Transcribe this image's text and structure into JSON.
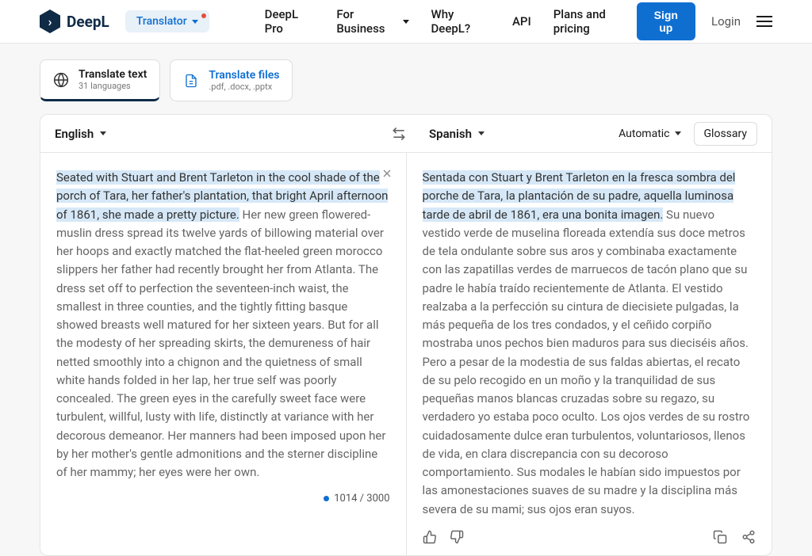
{
  "header": {
    "brand": "DeepL",
    "translator_label": "Translator",
    "nav": {
      "pro": "DeepL Pro",
      "business": "For Business",
      "why": "Why DeepL?",
      "api": "API",
      "plans": "Plans and pricing"
    },
    "signup": "Sign up",
    "login": "Login"
  },
  "modes": {
    "text": {
      "title": "Translate text",
      "sub": "31 languages"
    },
    "files": {
      "title": "Translate files",
      "sub": ".pdf, .docx, .pptx"
    }
  },
  "langbar": {
    "source": "English",
    "target": "Spanish",
    "automatic": "Automatic",
    "glossary": "Glossary"
  },
  "source": {
    "highlight": "Seated with Stuart and Brent Tarleton in the cool shade of the porch of Tara, her father's plantation, that bright April afternoon of 1861, she made a pretty picture.",
    "rest": " Her new green flowered-muslin dress spread its twelve yards of billowing material over her hoops and exactly matched the flat-heeled green morocco slippers her father had recently brought her from Atlanta. The dress set off to perfection the seventeen-inch waist, the smallest in three counties, and the tightly fitting basque showed breasts well matured for her sixteen years. But for all the modesty of her spreading skirts, the demureness of hair netted smoothly into a chignon and the quietness of small white hands folded in her lap, her true self was poorly concealed. The green eyes in the carefully sweet face were turbulent, willful, lusty with life, distinctly at variance with her decorous demeanor. Her manners had been imposed upon her by her mother's gentle admonitions and the sterner discipline of her mammy; her eyes were her own.",
    "count": "1014 / 3000"
  },
  "target": {
    "highlight": "Sentada con Stuart y Brent Tarleton en la fresca sombra del porche de Tara, la plantación de su padre, aquella luminosa tarde de abril de 1861, era una bonita imagen.",
    "rest": " Su nuevo vestido verde de muselina floreada extendía sus doce metros de tela ondulante sobre sus aros y combinaba exactamente con las zapatillas verdes de marruecos de tacón plano que su padre le había traído recientemente de Atlanta. El vestido realzaba a la perfección su cintura de diecisiete pulgadas, la más pequeña de los tres condados, y el ceñido corpiño mostraba unos pechos bien maduros para sus dieciséis años. Pero a pesar de la modestia de sus faldas abiertas, el recato de su pelo recogido en un moño y la tranquilidad de sus pequeñas manos blancas cruzadas sobre su regazo, su verdadero yo estaba poco oculto. Los ojos verdes de su rostro cuidadosamente dulce eran turbulentos, voluntariosos, llenos de vida, en clara discrepancia con su decoroso comportamiento. Sus modales le habían sido impuestos por las amonestaciones suaves de su madre y la disciplina más severa de su mami; sus ojos eran suyos."
  }
}
